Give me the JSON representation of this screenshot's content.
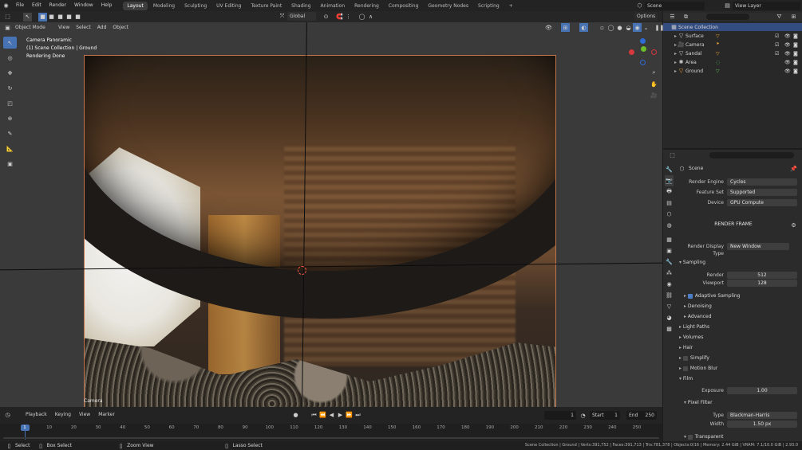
{
  "topbar": {
    "menus": [
      "File",
      "Edit",
      "Render",
      "Window",
      "Help"
    ],
    "workspaces": [
      "Layout",
      "Modeling",
      "Sculpting",
      "UV Editing",
      "Texture Paint",
      "Shading",
      "Animation",
      "Rendering",
      "Compositing",
      "Geometry Nodes",
      "Scripting"
    ],
    "active_workspace": "Layout",
    "add_tab": "+",
    "scene": "Scene",
    "view_layer": "View Layer"
  },
  "viewport_header": {
    "transform": "Global",
    "options": "Options"
  },
  "viewport_menu": {
    "mode": "Object Mode",
    "items": [
      "View",
      "Select",
      "Add",
      "Object"
    ]
  },
  "overlay_text": {
    "camera_info": "Camera Panoramic",
    "collection_info": "(1) Scene Collection | Ground",
    "status": "Rendering Done",
    "camera_label": "Camera"
  },
  "outliner": {
    "root": "Scene Collection",
    "items": [
      "Surface",
      "Camera",
      "Sandal",
      "Area",
      "Ground"
    ]
  },
  "properties": {
    "scene": "Scene",
    "render_engine_label": "Render Engine",
    "render_engine": "Cycles",
    "feature_set_label": "Feature Set",
    "feature_set": "Supported",
    "device_label": "Device",
    "device": "GPU Compute",
    "render_frame": "RENDER FRAME",
    "display_type_label": "Render Display Type",
    "display_type": "New Window",
    "sampling": "Sampling",
    "render_label": "Render",
    "render_value": "512",
    "viewport_label": "Viewport",
    "viewport_value": "128",
    "adaptive": "Adaptive Sampling",
    "denoising": "Denoising",
    "advanced": "Advanced",
    "light_paths": "Light Paths",
    "volumes": "Volumes",
    "hair": "Hair",
    "simplify": "Simplify",
    "motion_blur": "Motion Blur",
    "film": "Film",
    "exposure_label": "Exposure",
    "exposure": "1.00",
    "pixel_filter": "Pixel Filter",
    "type_label": "Type",
    "type": "Blackman-Harris",
    "width_label": "Width",
    "width": "1.50 px",
    "transparent": "Transparent"
  },
  "timeline": {
    "menus": [
      "Playback",
      "Keying",
      "View",
      "Marker"
    ],
    "current_frame": "1",
    "start_label": "Start",
    "start": "1",
    "end_label": "End",
    "end": "250",
    "ticks": [
      "1",
      "10",
      "20",
      "30",
      "40",
      "50",
      "60",
      "70",
      "80",
      "90",
      "100",
      "110",
      "120",
      "130",
      "140",
      "150",
      "160",
      "170",
      "180",
      "190",
      "200",
      "210",
      "220",
      "230",
      "240",
      "250"
    ]
  },
  "statusbar": {
    "select": "Select",
    "box_select": "Box Select",
    "zoom_view": "Zoom View",
    "lasso_select": "Lasso Select",
    "stats": "Scene Collection | Ground | Verts:391,752 | Faces:391,713 | Tris:781,378 | Objects:0/16 | Memory: 2.44 GiB | VRAM: 7.1/10.0 GiB | 2.93.0"
  }
}
